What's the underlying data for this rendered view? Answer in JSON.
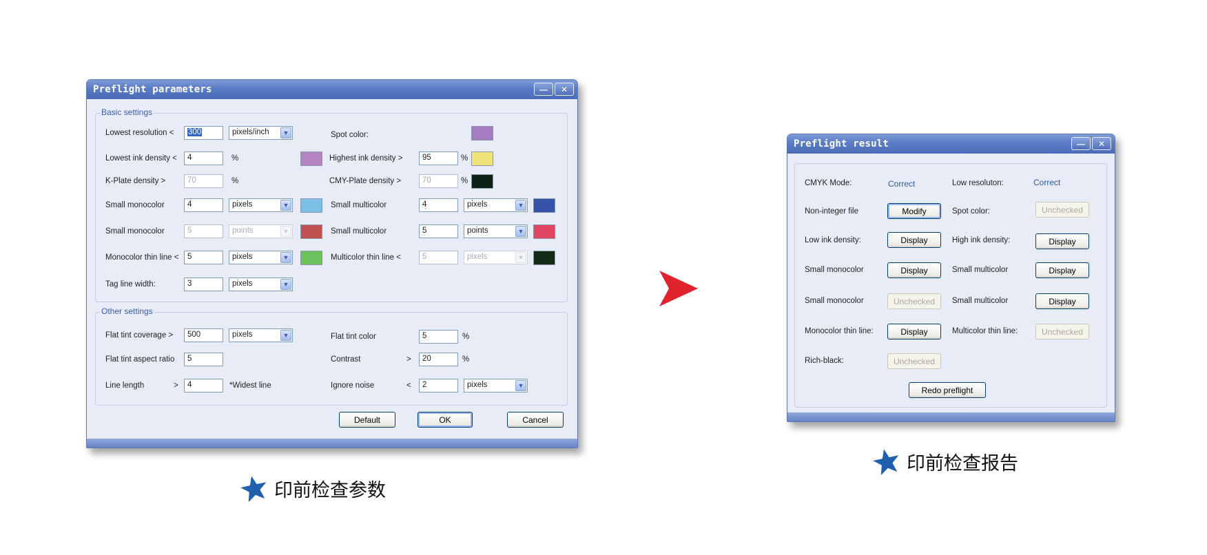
{
  "param_window": {
    "title": "Preflight parameters",
    "basic_legend": "Basic settings",
    "other_legend": "Other settings",
    "lowest_resolution": {
      "label": "Lowest resolution  <",
      "value": "300",
      "unit": "pixels/inch"
    },
    "spot_color": {
      "label": "Spot color:",
      "color": "#a67cc0"
    },
    "lowest_ink_density": {
      "label": "Lowest ink density <",
      "value": "4",
      "unit": "%",
      "color": "#b585c3"
    },
    "highest_ink_density": {
      "label": "Highest ink density  >",
      "value": "95",
      "unit": "%",
      "color": "#f0e37a"
    },
    "k_plate_density": {
      "label": "K-Plate density    >",
      "value": "70",
      "unit": "%"
    },
    "cmy_plate_density": {
      "label": "CMY-Plate density  >",
      "value": "70",
      "unit": "%",
      "color": "#0f2216"
    },
    "small_monocolor_1": {
      "label": "Small monocolor",
      "value": "4",
      "unit": "pixels",
      "color": "#7cbfe6"
    },
    "small_multicolor_1": {
      "label": "Small multicolor",
      "value": "4",
      "unit": "pixels",
      "color": "#3552a6"
    },
    "small_monocolor_2": {
      "label": "Small monocolor",
      "value": "5",
      "unit": "points",
      "color": "#c05150"
    },
    "small_multicolor_2": {
      "label": "Small multicolor",
      "value": "5",
      "unit": "points",
      "color": "#e2455f"
    },
    "monocolor_thin_line": {
      "label": "Monocolor thin line <",
      "value": "5",
      "unit": "pixels",
      "color": "#6bc15c"
    },
    "multicolor_thin_line": {
      "label": "Multicolor thin line <",
      "value": "5",
      "unit": "pixels",
      "color": "#132a17"
    },
    "tag_line_width": {
      "label": "Tag line width:",
      "value": "3",
      "unit": "pixels"
    },
    "flat_tint_coverage": {
      "label": "Flat tint coverage >",
      "value": "500",
      "unit": "pixels"
    },
    "flat_tint_color": {
      "label": "Flat tint color",
      "value": "5",
      "unit": "%"
    },
    "flat_tint_aspect_ratio": {
      "label": "Flat tint aspect ratio",
      "value": "5"
    },
    "contrast": {
      "label": "Contrast",
      "op": ">",
      "value": "20",
      "unit": "%"
    },
    "line_length": {
      "label": "Line length",
      "op": ">",
      "value": "4",
      "unit": "*Widest line"
    },
    "ignore_noise": {
      "label": "Ignore noise",
      "op": "<",
      "value": "2",
      "unit": "pixels"
    },
    "buttons": {
      "default": "Default",
      "ok": "OK",
      "cancel": "Cancel"
    }
  },
  "result_window": {
    "title": "Preflight result",
    "cmyk_mode": {
      "label": "CMYK Mode:",
      "value": "Correct"
    },
    "low_resolution": {
      "label": "Low resoluton:",
      "value": "Correct"
    },
    "non_integer_file": {
      "label": "Non-integer file",
      "button": "Modify"
    },
    "spot_color": {
      "label": "Spot color:",
      "button": "Unchecked"
    },
    "low_ink_density": {
      "label": "Low ink density:",
      "button": "Display"
    },
    "high_ink_density": {
      "label": "High ink density:",
      "button": "Display"
    },
    "small_monocolor_1": {
      "label": "Small monocolor",
      "button": "Display"
    },
    "small_multicolor_1": {
      "label": "Small multicolor",
      "button": "Display"
    },
    "small_monocolor_2": {
      "label": "Small monocolor",
      "button": "Unchecked"
    },
    "small_multicolor_2": {
      "label": "Small multicolor",
      "button": "Display"
    },
    "monocolor_thin_line": {
      "label": "Monocolor thin line:",
      "button": "Display"
    },
    "multicolor_thin_line": {
      "label": "Multicolor thin line:",
      "button": "Unchecked"
    },
    "rich_black": {
      "label": "Rich-black:",
      "button": "Unchecked"
    },
    "redo_button": "Redo preflight"
  },
  "captions": {
    "left": "印前检查参数",
    "right": "印前检查报告"
  },
  "colors": {
    "arrow": "#e0232d",
    "star": "#1f5fae",
    "title_bar": "#5a7cc6",
    "legend": "#3c5db1"
  }
}
